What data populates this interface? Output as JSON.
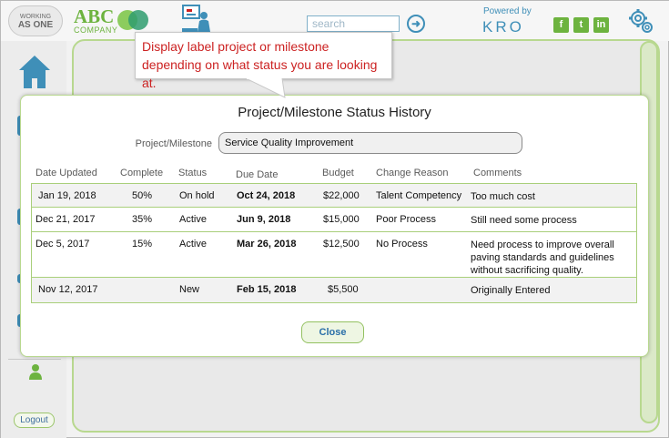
{
  "header": {
    "wao_logo_line1": "WORKING",
    "wao_logo_line2": "AS ONE",
    "abc_logo": "ABC",
    "abc_company": "COMPANY",
    "search_placeholder": "search",
    "search_go_icon": "arrow-right-circle-icon",
    "powered_by": "Powered by",
    "kro_logo": "KRO",
    "social": [
      {
        "name": "facebook-icon",
        "glyph": "f"
      },
      {
        "name": "twitter-icon",
        "glyph": "t"
      },
      {
        "name": "linkedin-icon",
        "glyph": "in"
      }
    ],
    "settings_icon": "gear-icon"
  },
  "left_rail": {
    "home_icon": "home-icon",
    "user_icon": "user-icon",
    "logout_label": "Logout"
  },
  "callout": {
    "text": "Display label project or milestone depending on what status you are looking at."
  },
  "modal": {
    "title": "Project/Milestone Status History",
    "field_label": "Project/Milestone",
    "field_value": "Service Quality Improvement",
    "columns": [
      "Date Updated",
      "Complete",
      "Status",
      "Due Date",
      "Budget",
      "Change Reason",
      "Comments"
    ],
    "rows": [
      {
        "date": "Jan 19, 2018",
        "complete": "50%",
        "status": "On hold",
        "due": "Oct 24, 2018",
        "budget": "$22,000",
        "reason": "Talent Competency",
        "comment": "Too much cost"
      },
      {
        "date": "Dec 21, 2017",
        "complete": "35%",
        "status": "Active",
        "due": "Jun 9, 2018",
        "budget": "$15,000",
        "reason": "Poor Process",
        "comment": "Still need some process"
      },
      {
        "date": "Dec 5, 2017",
        "complete": "15%",
        "status": "Active",
        "due": "Mar 26, 2018",
        "budget": "$12,500",
        "reason": "No Process",
        "comment": "Need process to improve overall paving standards and guidelines without sacrificing quality."
      },
      {
        "date": "Nov 12, 2017",
        "complete": "",
        "status": "New",
        "due": "Feb 15, 2018",
        "budget": "$5,500",
        "reason": "",
        "comment": "Originally Entered"
      }
    ],
    "close_label": "Close"
  },
  "colors": {
    "accent_green": "#6db33f",
    "border_green": "#a9cf7a",
    "link_blue": "#3f8fb8",
    "callout_red": "#cc2222"
  }
}
